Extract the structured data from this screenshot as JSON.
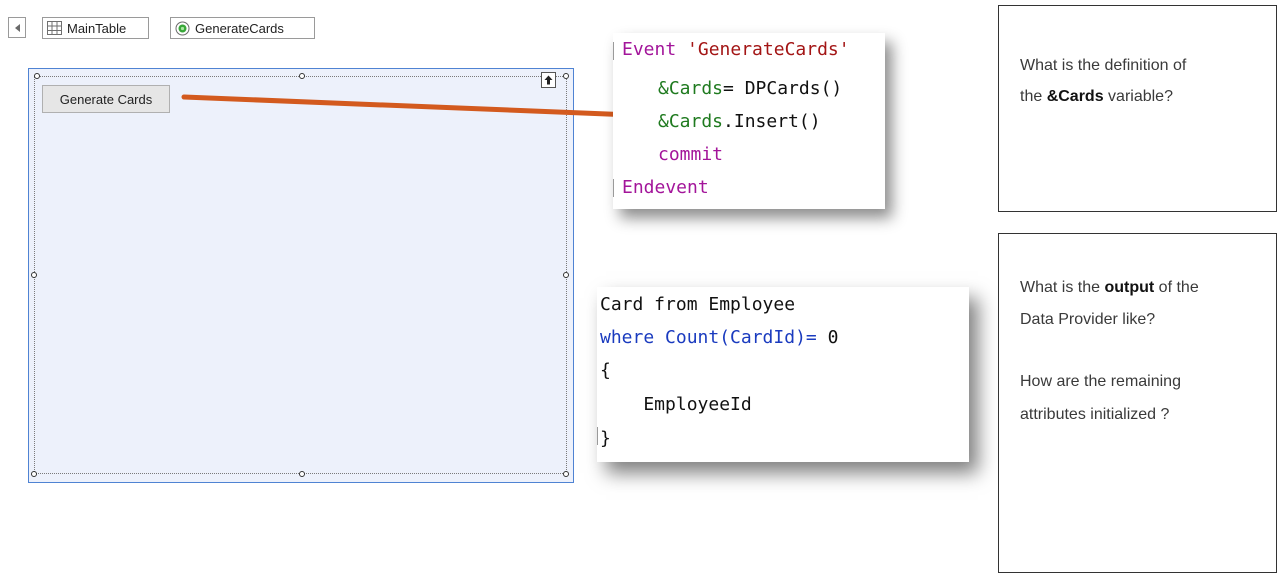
{
  "breadcrumb": {
    "items": [
      {
        "label": "MainTable",
        "icon": "table-icon"
      },
      {
        "label": "GenerateCards",
        "icon": "radio-selected-icon"
      }
    ]
  },
  "form": {
    "button_label": "Generate Cards"
  },
  "event_code": {
    "line1_kw": "Event",
    "line1_str": "'GenerateCards'",
    "line2_var": "&Cards",
    "line2_rest": "= DPCards()",
    "line3_var": "&Cards",
    "line3_rest": ".Insert()",
    "line4_kw": "commit",
    "line5_kw": "Endevent"
  },
  "dp_code": {
    "line1": "Card from Employee",
    "line2_blue": "where Count(CardId)=",
    "line2_num": " 0",
    "line3": "{",
    "line4": "    EmployeeId",
    "line5": "}"
  },
  "question1": {
    "line1": "What is the definition of",
    "line2_pre": "the ",
    "line2_bold": "&Cards",
    "line2_post": " variable?"
  },
  "question2": {
    "line1_pre": "What is the ",
    "line1_bold": "output",
    "line1_post": " of the",
    "line2": "Data Provider like?",
    "line3": "How are the remaining",
    "line4": "attributes initialized ?"
  },
  "colors": {
    "arrow": "#d35a1e",
    "canvas_border": "#4f83d3",
    "canvas_fill": "#edf1fb",
    "keyword": "#a3159a",
    "string": "#a31515",
    "variable": "#1f7a1f"
  }
}
